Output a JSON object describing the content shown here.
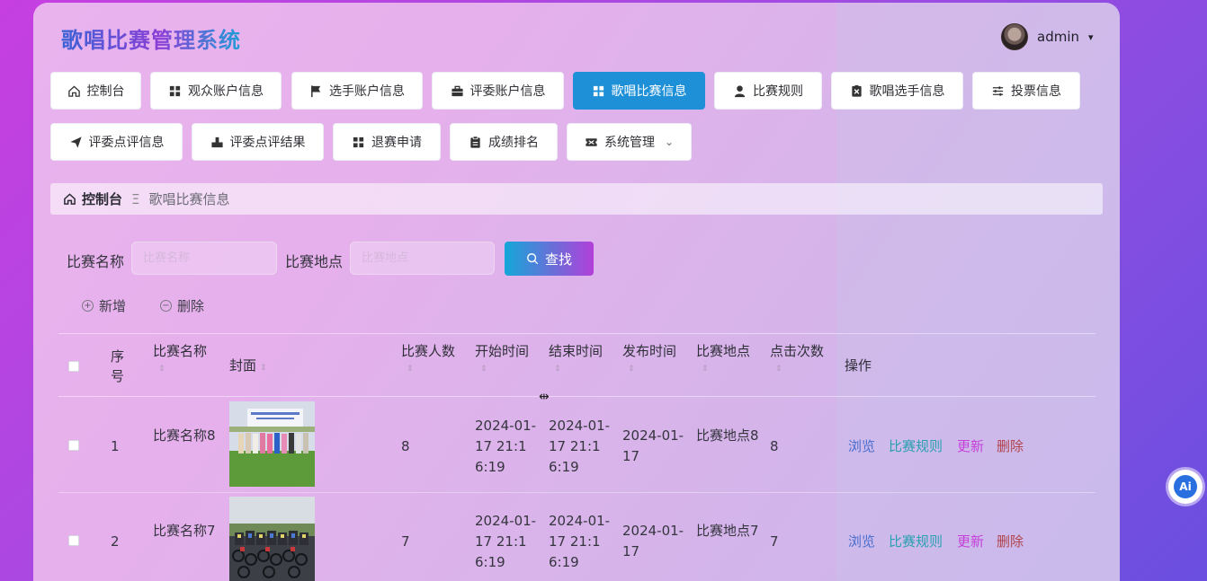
{
  "header": {
    "title": "歌唱比赛管理系统",
    "username": "admin",
    "caret": "▾"
  },
  "nav": {
    "row1": [
      {
        "label": "控制台",
        "icon": "home-icon",
        "active": false
      },
      {
        "label": "观众账户信息",
        "icon": "grid-icon",
        "active": false
      },
      {
        "label": "选手账户信息",
        "icon": "flag-icon",
        "active": false
      },
      {
        "label": "评委账户信息",
        "icon": "briefcase-icon",
        "active": false
      },
      {
        "label": "歌唱比赛信息",
        "icon": "grid-icon",
        "active": true
      },
      {
        "label": "比赛规则",
        "icon": "user-icon",
        "active": false
      },
      {
        "label": "歌唱选手信息",
        "icon": "close-box-icon",
        "active": false
      },
      {
        "label": "投票信息",
        "icon": "sliders-icon",
        "active": false
      }
    ],
    "row2": [
      {
        "label": "评委点评信息",
        "icon": "send-icon",
        "active": false
      },
      {
        "label": "评委点评结果",
        "icon": "stamp-icon",
        "active": false
      },
      {
        "label": "退赛申请",
        "icon": "grid-icon",
        "active": false
      },
      {
        "label": "成绩排名",
        "icon": "clipboard-icon",
        "active": false
      },
      {
        "label": "系统管理",
        "icon": "ticket-icon",
        "active": false,
        "dropdown": "⌄"
      }
    ]
  },
  "breadcrumb": {
    "home": "控制台",
    "separator": "Ξ",
    "current": "歌唱比赛信息"
  },
  "search": {
    "name_label": "比赛名称",
    "name_placeholder": "比赛名称",
    "place_label": "比赛地点",
    "place_placeholder": "比赛地点",
    "find_label": "查找"
  },
  "actions": {
    "add_label": "新增",
    "delete_label": "删除"
  },
  "table": {
    "headers": {
      "index": "序号",
      "name": "比赛名称",
      "cover": "封面",
      "count": "比赛人数",
      "start": "开始时间",
      "end": "结束时间",
      "publish": "发布时间",
      "place": "比赛地点",
      "clicks": "点击次数",
      "ops": "操作"
    },
    "sort_glyph": "⇕",
    "rows": [
      {
        "index": "1",
        "name": "比赛名称8",
        "count": "8",
        "start": "2024-01-17 21:16:19",
        "end": "2024-01-17 21:16:19",
        "publish": "2024-01-17",
        "place": "比赛地点8",
        "clicks": "8",
        "ops": {
          "view": "浏览",
          "rule": "比赛规则",
          "update": "更新",
          "delete": "删除"
        }
      },
      {
        "index": "2",
        "name": "比赛名称7",
        "count": "7",
        "start": "2024-01-17 21:16:19",
        "end": "2024-01-17 21:16:19",
        "publish": "2024-01-17",
        "place": "比赛地点7",
        "clicks": "7",
        "ops": {
          "view": "浏览",
          "rule": "比赛规则",
          "update": "更新",
          "delete": "删除"
        }
      }
    ]
  },
  "floating": {
    "ai_label": "Ai"
  }
}
